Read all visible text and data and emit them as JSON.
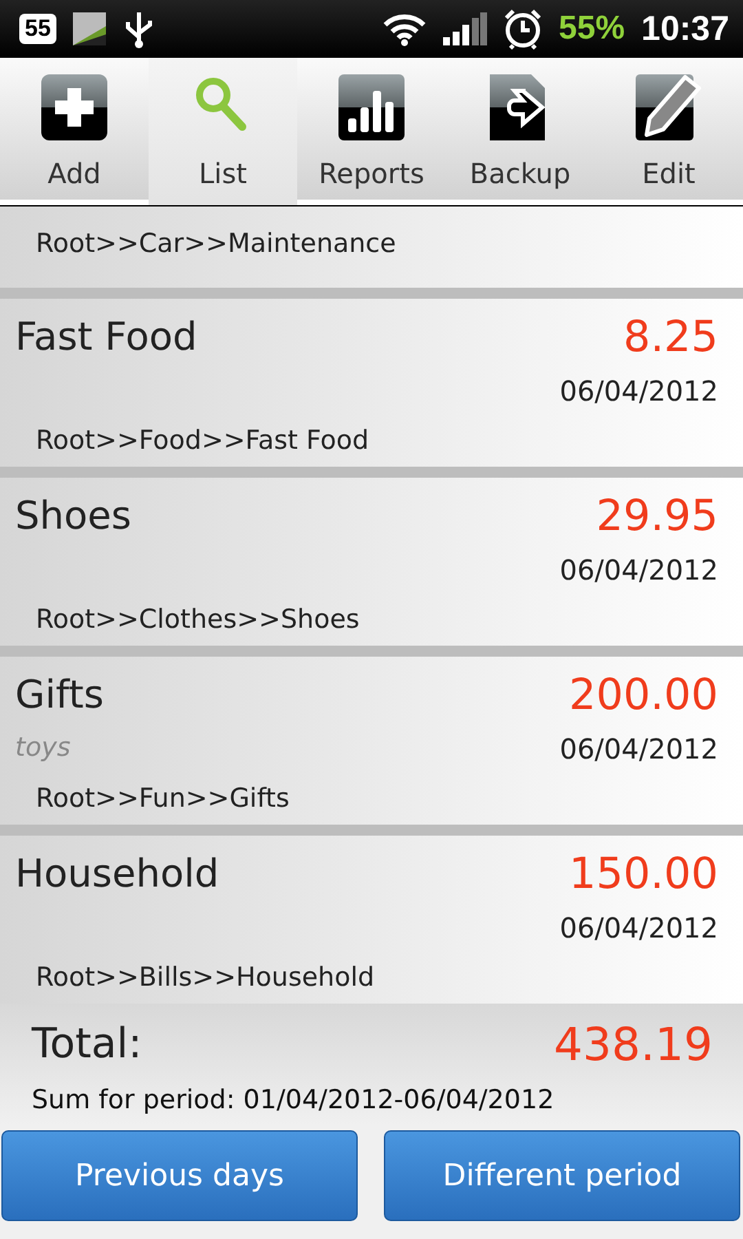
{
  "status_bar": {
    "notification_count": "55",
    "battery_percent": "55%",
    "time": "10:37"
  },
  "toolbar": [
    {
      "label": "Add",
      "selected": false
    },
    {
      "label": "List",
      "selected": true
    },
    {
      "label": "Reports",
      "selected": false
    },
    {
      "label": "Backup",
      "selected": false
    },
    {
      "label": "Edit",
      "selected": false
    }
  ],
  "expenses": [
    {
      "path": "Root>>Car>>Maintenance"
    },
    {
      "name": "Fast Food",
      "amount": "8.25",
      "date": "06/04/2012",
      "path": "Root>>Food>>Fast Food"
    },
    {
      "name": "Shoes",
      "amount": "29.95",
      "date": "06/04/2012",
      "path": "Root>>Clothes>>Shoes"
    },
    {
      "name": "Gifts",
      "note": "toys",
      "amount": "200.00",
      "date": "06/04/2012",
      "path": "Root>>Fun>>Gifts"
    },
    {
      "name": "Household",
      "amount": "150.00",
      "date": "06/04/2012",
      "path": "Root>>Bills>>Household"
    }
  ],
  "total": {
    "label": "Total:",
    "amount": "438.19",
    "period": "Sum for period: 01/04/2012-06/04/2012"
  },
  "buttons": [
    "Previous days",
    "Different period"
  ]
}
